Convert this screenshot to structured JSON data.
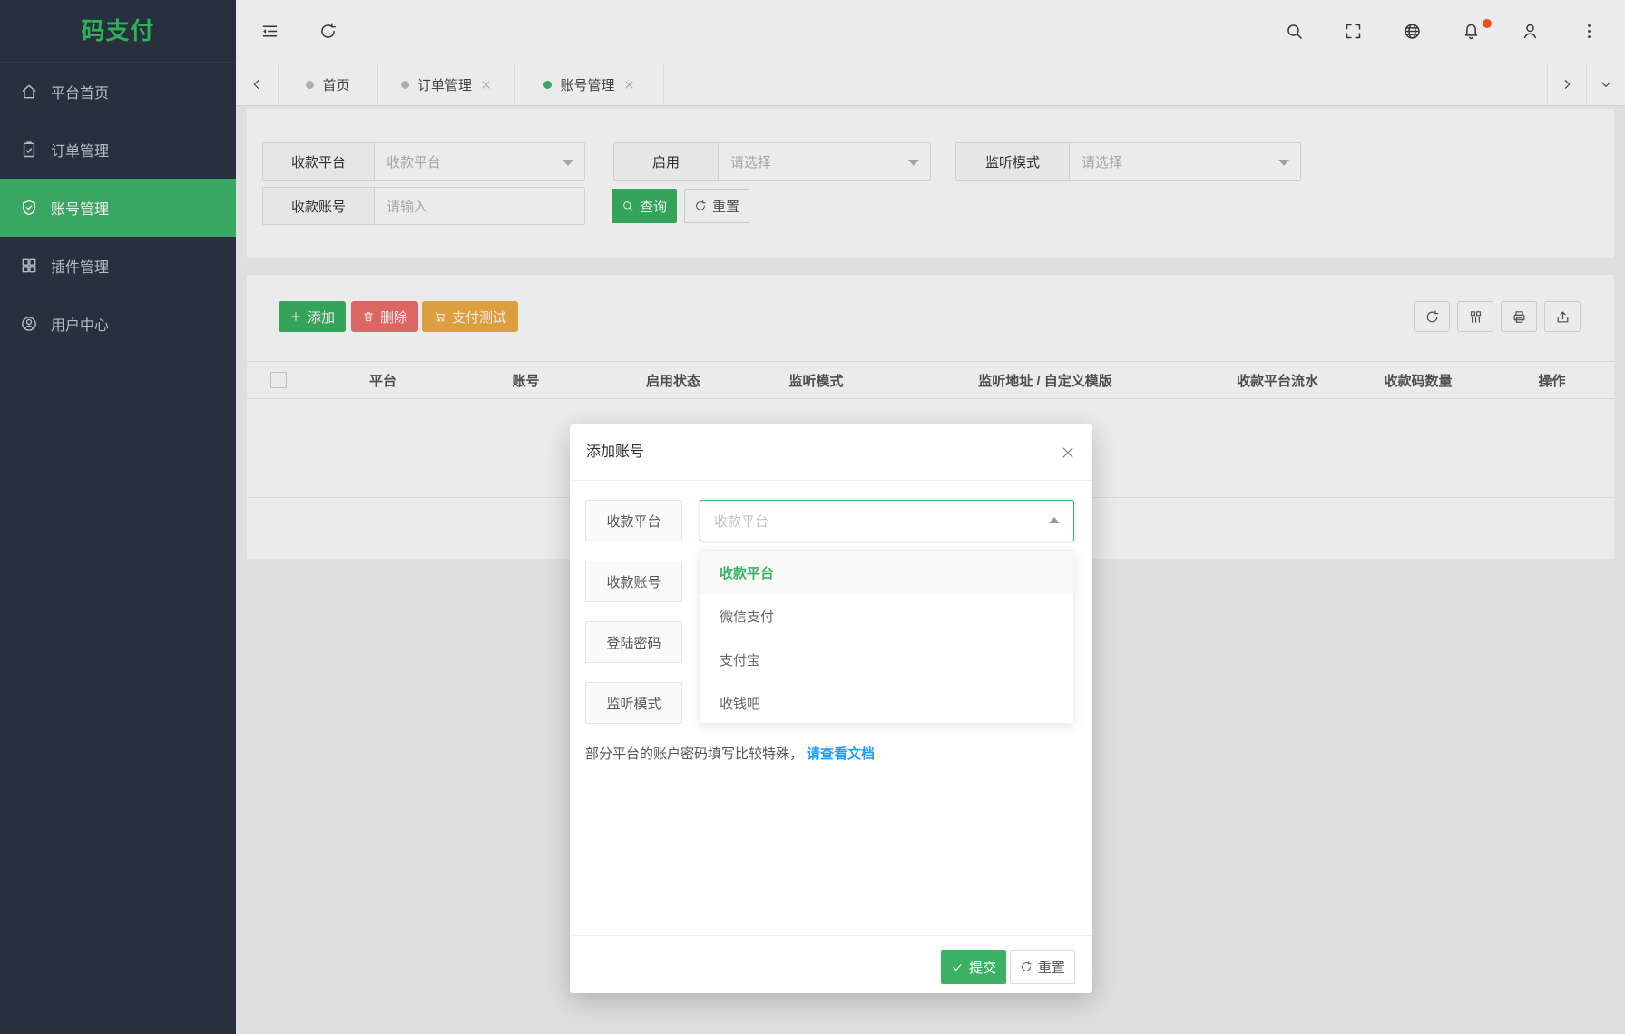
{
  "sidebar": {
    "logo": "码支付",
    "items": [
      {
        "label": "平台首页"
      },
      {
        "label": "订单管理"
      },
      {
        "label": "账号管理",
        "active": true
      },
      {
        "label": "插件管理"
      },
      {
        "label": "用户中心"
      }
    ]
  },
  "tabs": {
    "items": [
      {
        "label": "首页"
      },
      {
        "label": "订单管理"
      },
      {
        "label": "账号管理",
        "active": true
      }
    ]
  },
  "filter": {
    "platform_label": "收款平台",
    "platform_placeholder": "收款平台",
    "enable_label": "启用",
    "enable_placeholder": "请选择",
    "listen_label": "监听模式",
    "listen_placeholder": "请选择",
    "account_label": "收款账号",
    "account_placeholder": "请输入",
    "query_btn": "查询",
    "reset_btn": "重置"
  },
  "toolbar": {
    "add": "添加",
    "delete": "删除",
    "pay_test": "支付测试"
  },
  "table": {
    "headers": [
      "平台",
      "账号",
      "启用状态",
      "监听模式",
      "监听地址 / 自定义模版",
      "收款平台流水",
      "收款码数量",
      "操作"
    ]
  },
  "modal": {
    "title": "添加账号",
    "fields": [
      {
        "label": "收款平台",
        "placeholder": "收款平台"
      },
      {
        "label": "收款账号"
      },
      {
        "label": "登陆密码"
      },
      {
        "label": "监听模式"
      }
    ],
    "dropdown": {
      "options": [
        {
          "label": "收款平台",
          "selected": true
        },
        {
          "label": "微信支付"
        },
        {
          "label": "支付宝"
        },
        {
          "label": "收钱吧"
        }
      ]
    },
    "hint": "部分平台的账户密码填写比较特殊，",
    "hint_link": "请查看文档",
    "submit_btn": "提交",
    "reset_btn": "重置"
  },
  "colors": {
    "accent_green": "#3bb163",
    "logo_green": "#31c35e",
    "danger_red": "#ee6f6c",
    "warning_orange": "#f0ac45",
    "link_blue": "#1e9fff",
    "notification_badge": "#ff5722",
    "sidebar_bg": "#2b3542"
  }
}
